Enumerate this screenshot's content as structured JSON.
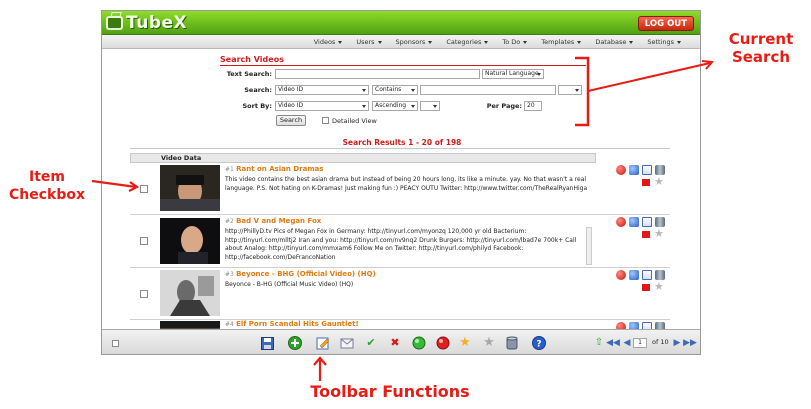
{
  "app": {
    "logo": "TubeX",
    "logout_label": "LOG OUT",
    "accent_color": "#5aae17",
    "link_color": "#e07a10",
    "heading_color": "#d01c1c"
  },
  "menu": [
    {
      "label": "Videos"
    },
    {
      "label": "Users"
    },
    {
      "label": "Sponsors"
    },
    {
      "label": "Categories"
    },
    {
      "label": "To Do"
    },
    {
      "label": "Templates"
    },
    {
      "label": "Database"
    },
    {
      "label": "Settings"
    }
  ],
  "search": {
    "title": "Search Videos",
    "text_search_label": "Text Search:",
    "text_search_value": "",
    "text_mode": "Natural Language",
    "search_label": "Search:",
    "search_field": "Video ID",
    "search_operator": "Contains",
    "search_value": "",
    "search_extra": "",
    "sort_label": "Sort By:",
    "sort_field": "Video ID",
    "sort_order": "Ascending",
    "sort_extra": "",
    "per_page_label": "Per Page:",
    "per_page_value": "20",
    "search_button": "Search",
    "detailed_view_label": "Detailed View"
  },
  "results": {
    "title": "Search Results 1 - 20 of 198",
    "column_header": "Video Data",
    "rows": [
      {
        "num": "#1",
        "title": "Rant on Asian Dramas",
        "description": "This video contains the best asian drama but instead of being 20 hours long, its like a minute. yay. No that wasn't a real language. P.S. Not hating on K-Dramas! Just making fun :) PEACY OUTU Twitter: http://www.twitter.com/TheRealRyanHiga"
      },
      {
        "num": "#2",
        "title": "Bad V and Megan Fox",
        "description": "http://PhillyD.tv Pics of Megan Fox in Germany: http://tinyurl.com/myonzq 120,000 yr old Bacterium: http://tinyurl.com/mlltj2 Iran and you: http://tinyurl.com/nv9nq2 Drunk Burgers: http://tinyurl.com/lbad7e 700k+ Call about Analog: http://tinyurl.com/mmxam6 Follow Me on Twitter: http://tinyurl.com/philyd Facebook: http://facebook.com/DeFrancoNation"
      },
      {
        "num": "#3",
        "title": "Beyonce - BHG (Official Video) (HQ)",
        "description": "Beyonce - B-HG (Official Music Video) (HQ)"
      },
      {
        "num": "#4",
        "title": "Elf Porn Scandal Hits Gauntlet!",
        "description": ""
      }
    ]
  },
  "pagination": {
    "current_page": "1",
    "of_label": "of 10"
  },
  "callouts": {
    "current_search": "Current Search",
    "item_checkbox": "Item Checkbox",
    "toolbar_functions": "Toolbar Functions"
  }
}
